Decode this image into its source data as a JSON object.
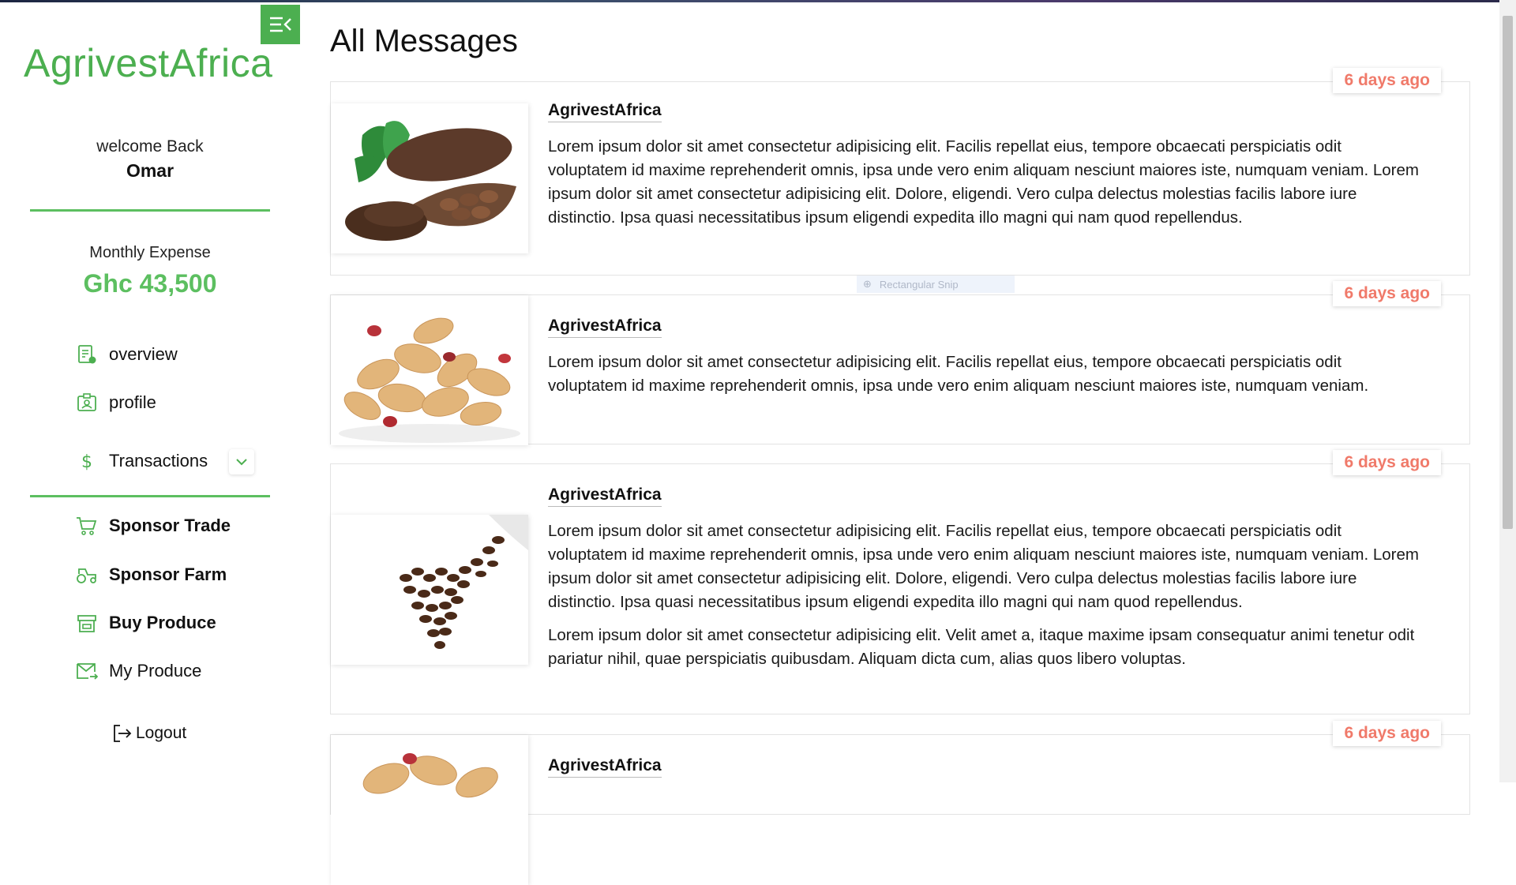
{
  "sidebar": {
    "brand": "AgrivestAfrica",
    "welcome": "welcome Back",
    "username": "Omar",
    "expense_label": "Monthly Expense",
    "expense_value": "Ghc 43,500",
    "nav": [
      {
        "label": "overview",
        "icon": "overview-icon"
      },
      {
        "label": "profile",
        "icon": "profile-icon"
      },
      {
        "label": "Transactions",
        "icon": "dollar-icon"
      }
    ],
    "actions": [
      {
        "label": "Sponsor Trade",
        "icon": "cart-icon"
      },
      {
        "label": "Sponsor Farm",
        "icon": "tractor-icon"
      },
      {
        "label": "Buy Produce",
        "icon": "store-icon"
      },
      {
        "label": "My Produce",
        "icon": "mail-arrow-icon"
      }
    ],
    "logout": "Logout",
    "accent": "#4caf50"
  },
  "main": {
    "title": "All Messages",
    "snip_overlay": "Rectangular Snip",
    "messages": [
      {
        "sender": "AgrivestAfrica",
        "time": "6 days ago",
        "image": "cocoa-beans-image",
        "paragraphs": [
          "Lorem ipsum dolor sit amet consectetur adipisicing elit. Facilis repellat eius, tempore obcaecati perspiciatis odit voluptatem id maxime reprehenderit omnis, ipsa unde vero enim aliquam nesciunt maiores iste, numquam veniam. Lorem ipsum dolor sit amet consectetur adipisicing elit. Dolore, eligendi. Vero culpa delectus molestias facilis labore iure distinctio. Ipsa quasi necessitatibus ipsum eligendi expedita illo magni qui nam quod repellendus."
        ]
      },
      {
        "sender": "AgrivestAfrica",
        "time": "6 days ago",
        "image": "peanuts-image",
        "paragraphs": [
          "Lorem ipsum dolor sit amet consectetur adipisicing elit. Facilis repellat eius, tempore obcaecati perspiciatis odit voluptatem id maxime reprehenderit omnis, ipsa unde vero enim aliquam nesciunt maiores iste, numquam veniam."
        ]
      },
      {
        "sender": "AgrivestAfrica",
        "time": "6 days ago",
        "image": "coffee-beans-image",
        "paragraphs": [
          "Lorem ipsum dolor sit amet consectetur adipisicing elit. Facilis repellat eius, tempore obcaecati perspiciatis odit voluptatem id maxime reprehenderit omnis, ipsa unde vero enim aliquam nesciunt maiores iste, numquam veniam. Lorem ipsum dolor sit amet consectetur adipisicing elit. Dolore, eligendi. Vero culpa delectus molestias facilis labore iure distinctio. Ipsa quasi necessitatibus ipsum eligendi expedita illo magni qui nam quod repellendus.",
          "Lorem ipsum dolor sit amet consectetur adipisicing elit. Velit amet a, itaque maxime ipsam consequatur animi tenetur odit pariatur nihil, quae perspiciatis quibusdam. Aliquam dicta cum, alias quos libero voluptas."
        ]
      },
      {
        "sender": "AgrivestAfrica",
        "time": "6 days ago",
        "image": "peanuts-image",
        "paragraphs": []
      }
    ]
  }
}
